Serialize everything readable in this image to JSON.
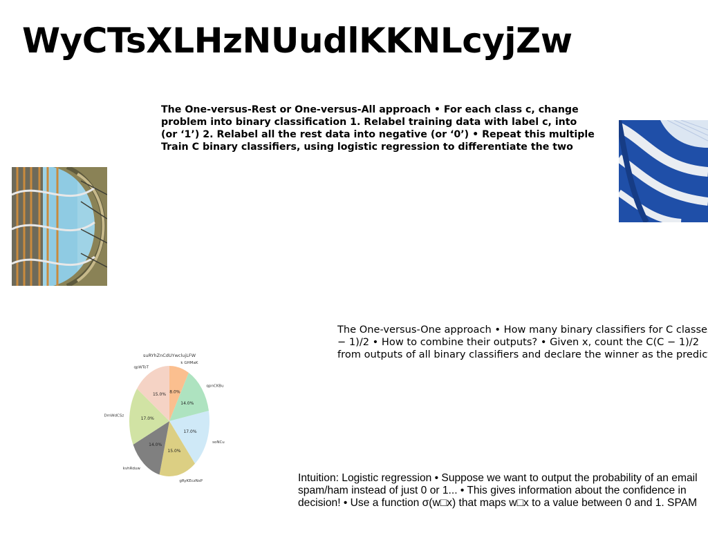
{
  "slide": {
    "title": "WyCTsXLHzNUudlKKNLcyjZw",
    "block1_lines": [
      "The One-versus-Rest or One-versus-All approach • For each class c, change",
      "problem into binary classification 1. Relabel training data with label c, into",
      "(or ‘1’) 2. Relabel all the rest data into negative (or ‘0’) • Repeat this multiple",
      "Train C binary classifiers, using logistic regression to differentiate the two"
    ],
    "block2_lines": [
      "The One-versus-One approach • How many binary classifiers for C classes?",
      "− 1)/2 • How to combine their outputs? • Given x, count the C(C − 1)/2",
      "from outputs of all binary classifiers and declare the winner as the predicted"
    ],
    "block3_lines": [
      "Intuition: Logistic regression • Suppose we want to output the probability of an email",
      "spam/ham instead of just 0 or 1... • This gives information about the confidence in",
      "decision! • Use a function σ(w□x) that maps w□x to a value between 0 and 1. SPAM"
    ]
  },
  "chart_data": {
    "type": "pie",
    "title": "suRYhZnCdUYwclujLFW",
    "slices": [
      {
        "label": "k GHMaK",
        "value": 8.0,
        "pct_label": "8.0%",
        "color": "#fbbf8f"
      },
      {
        "label": "qpnCKBu",
        "value": 14.0,
        "pct_label": "14.0%",
        "color": "#aee3c0"
      },
      {
        "label": "soNCu",
        "value": 17.0,
        "pct_label": "17.0%",
        "color": "#cfe9f7"
      },
      {
        "label": "gRyKEczNsP",
        "value": 15.0,
        "pct_label": "15.0%",
        "color": "#dccf83"
      },
      {
        "label": "kvhRduw",
        "value": 14.0,
        "pct_label": "14.0%",
        "color": "#808080"
      },
      {
        "label": "DmWdCSz",
        "value": 17.0,
        "pct_label": "17.0%",
        "color": "#d1e3a4"
      },
      {
        "label": "qpWToT",
        "value": 15.0,
        "pct_label": "15.0%",
        "color": "#f5d3c5"
      }
    ]
  }
}
